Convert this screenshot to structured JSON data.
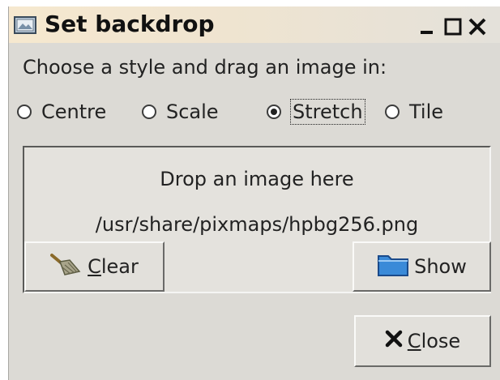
{
  "window": {
    "title": "Set backdrop",
    "controls": {
      "minimize": "minimize-icon",
      "maximize": "maximize-icon",
      "close": "close-icon"
    }
  },
  "prompt": "Choose a style and drag an image in:",
  "styles": {
    "options": [
      "Centre",
      "Scale",
      "Stretch",
      "Tile"
    ],
    "selected": "Stretch"
  },
  "dropzone": {
    "title": "Drop an image here",
    "path": "/usr/share/pixmaps/hpbg256.png"
  },
  "buttons": {
    "clear": {
      "mnemonic": "C",
      "rest": "lear",
      "icon": "broom-icon"
    },
    "show": {
      "label": "Show",
      "icon": "folder-icon"
    },
    "close": {
      "mnemonic": "C",
      "rest": "lose",
      "icon": "x-icon"
    }
  }
}
